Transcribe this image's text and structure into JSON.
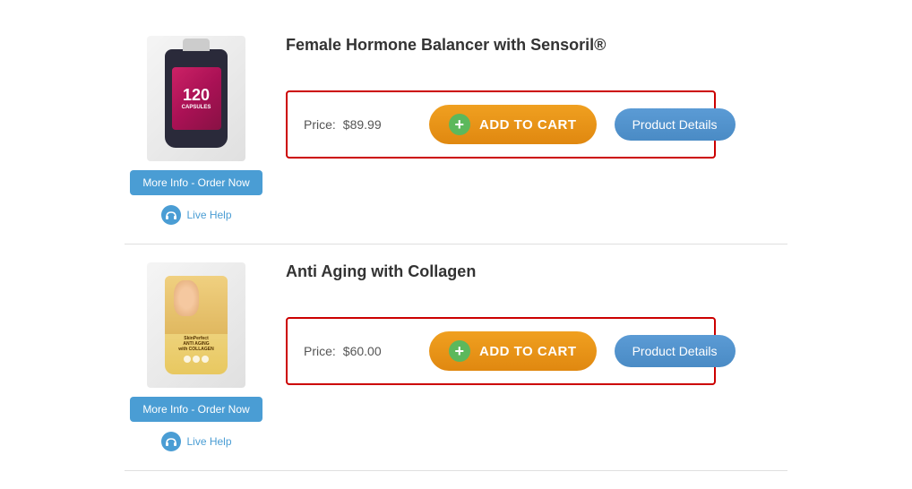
{
  "products": [
    {
      "id": "product-1",
      "title": "Female Hormone Balancer with Sensoril®",
      "price_label": "Price:",
      "price_value": "$89.99",
      "add_to_cart_label": "ADD TO CART",
      "product_details_label": "Product Details",
      "more_info_label": "More Info - Order Now",
      "live_help_label": "Live Help",
      "bottle_num": "120"
    },
    {
      "id": "product-2",
      "title": "Anti Aging with Collagen",
      "price_label": "Price:",
      "price_value": "$60.00",
      "add_to_cart_label": "ADD TO CART",
      "product_details_label": "Product Details",
      "more_info_label": "More Info - Order Now",
      "live_help_label": "Live Help"
    }
  ],
  "icons": {
    "plus": "+",
    "headset": "🎧"
  }
}
